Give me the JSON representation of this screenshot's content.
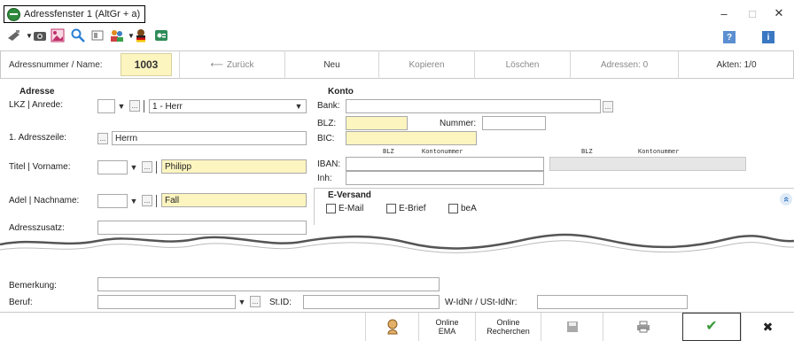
{
  "window": {
    "title": "Adressfenster 1 (AltGr + a)",
    "minimize": "–",
    "maximize": "□",
    "close": "✕"
  },
  "toolbar": {
    "help_icon": "?",
    "info_icon": "i"
  },
  "nav": {
    "number_label": "Adressnummer / Name:",
    "number_value": "1003",
    "back_label": "Zurück",
    "new_label": "Neu",
    "copy_label": "Kopieren",
    "delete_label": "Löschen",
    "addresses_label": "Adressen: 0",
    "files_label": "Akten: 1/0"
  },
  "address": {
    "heading": "Adresse",
    "lkz_label": "LKZ | Anrede:",
    "lkz_button": "...",
    "salutation_value": "1  - Herr",
    "line1_label": "1. Adresszeile:",
    "line1_button": "...",
    "line1_value": "Herrn",
    "title_label": "Titel | Vorname:",
    "title_button": "...",
    "firstname_value": "Philipp",
    "nobility_label": "Adel | Nachname:",
    "nobility_button": "...",
    "lastname_value": "Fall",
    "addition_label": "Adresszusatz:"
  },
  "account": {
    "heading": "Konto",
    "bank_label": "Bank:",
    "bank_button": "...",
    "blz_label": "BLZ:",
    "number_label": "Nummer:",
    "bic_label": "BIC:",
    "iban_label": "IBAN:",
    "holder_label": "Inh:",
    "col_blz": "BLZ",
    "col_number": "Kontonummer",
    "col_blz2": "BLZ",
    "col_number2": "Kontonummer"
  },
  "eversand": {
    "heading": "E-Versand",
    "email": "E-Mail",
    "ebrief": "E-Brief",
    "bea": "beA",
    "collapse_icon": "«"
  },
  "bottom": {
    "remark_label": "Bemerkung:",
    "job_label": "Beruf:",
    "job_button": "...",
    "stid_label": "St.ID:",
    "vat_label": "W-IdNr / USt-IdNr:"
  },
  "footer": {
    "online_ema": "Online EMA",
    "online_recherchen": "Online Recherchen",
    "ok_icon": "✔",
    "cancel_icon": "✖"
  }
}
